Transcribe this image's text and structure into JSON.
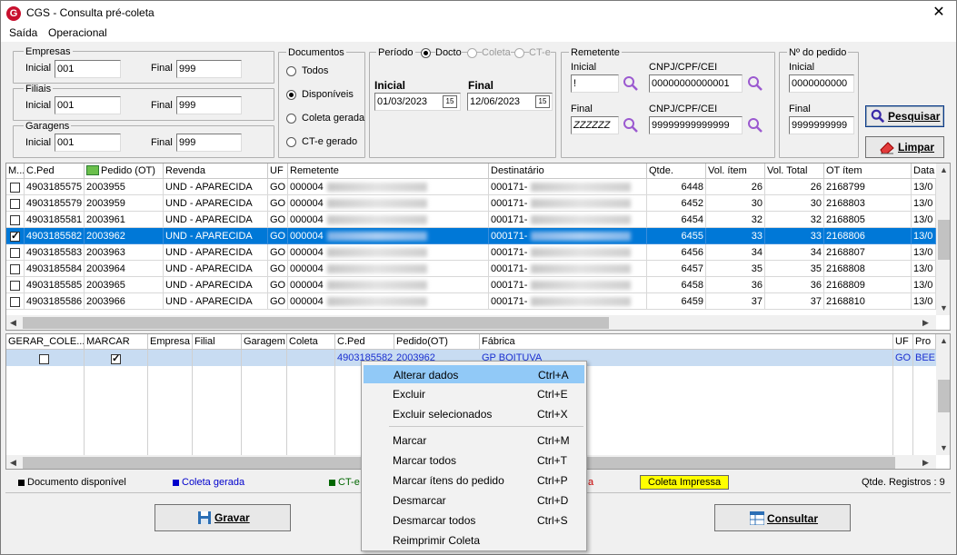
{
  "window": {
    "title": "CGS - Consulta pré-coleta",
    "close": "✕"
  },
  "menu": [
    "Saída",
    "Operacional"
  ],
  "filters": {
    "empresas": {
      "legend": "Empresas",
      "inicial_label": "Inicial",
      "inicial": "001",
      "final_label": "Final",
      "final": "999"
    },
    "filiais": {
      "legend": "Filiais",
      "inicial_label": "Inicial",
      "inicial": "001",
      "final_label": "Final",
      "final": "999"
    },
    "garagens": {
      "legend": "Garagens",
      "inicial_label": "Inicial",
      "inicial": "001",
      "final_label": "Final",
      "final": "999"
    },
    "documentos": {
      "legend": "Documentos",
      "options": [
        "Todos",
        "Disponíveis",
        "Coleta gerada",
        "CT-e gerado"
      ],
      "selected": "Disponíveis"
    },
    "periodo": {
      "legend": "Período",
      "options": [
        "Docto",
        "Coleta",
        "CT-e"
      ],
      "selected": "Docto",
      "inicial_label": "Inicial",
      "inicial": "01/03/2023",
      "final_label": "Final",
      "final": "12/06/2023",
      "cal_icon": "15"
    },
    "remetente": {
      "legend": "Remetente",
      "inicial_label": "Inicial",
      "inicial": "!",
      "cnpj_label": "CNPJ/CPF/CEI",
      "cnpj_inicial": "00000000000001",
      "final_label": "Final",
      "final": "ZZZZZZ",
      "cnpj_final": "99999999999999"
    },
    "pedido": {
      "legend": "Nº do pedido",
      "inicial_label": "Inicial",
      "inicial": "0000000000",
      "final_label": "Final",
      "final": "9999999999"
    }
  },
  "buttons": {
    "pesquisar": "Pesquisar",
    "limpar": "Limpar",
    "gravar": "Gravar",
    "consultar": "Consultar"
  },
  "top_grid": {
    "headers": [
      "M...",
      "C.Ped",
      "Pedido (OT)",
      "Revenda",
      "UF",
      "Remetente",
      "Destinatário",
      "Qtde.",
      "Vol. ítem",
      "Vol. Total",
      "OT ítem",
      "Data"
    ],
    "rows": [
      {
        "checked": false,
        "cped": "4903185575",
        "pedido": "2003955",
        "revenda": "UND - APARECIDA",
        "uf": "GO",
        "rem": "000004",
        "dest": "000171-",
        "qtde": "6448",
        "vol_item": "26",
        "vol_total": "26",
        "ot_item": "2168799",
        "data": "13/0"
      },
      {
        "checked": false,
        "cped": "4903185579",
        "pedido": "2003959",
        "revenda": "UND - APARECIDA",
        "uf": "GO",
        "rem": "000004",
        "dest": "000171-",
        "qtde": "6452",
        "vol_item": "30",
        "vol_total": "30",
        "ot_item": "2168803",
        "data": "13/0"
      },
      {
        "checked": false,
        "cped": "4903185581",
        "pedido": "2003961",
        "revenda": "UND - APARECIDA",
        "uf": "GO",
        "rem": "000004",
        "dest": "000171-",
        "qtde": "6454",
        "vol_item": "32",
        "vol_total": "32",
        "ot_item": "2168805",
        "data": "13/0"
      },
      {
        "checked": true,
        "cped": "4903185582",
        "pedido": "2003962",
        "revenda": "UND - APARECIDA",
        "uf": "GO",
        "rem": "000004",
        "dest": "000171-",
        "qtde": "6455",
        "vol_item": "33",
        "vol_total": "33",
        "ot_item": "2168806",
        "data": "13/0",
        "selected": true
      },
      {
        "checked": false,
        "cped": "4903185583",
        "pedido": "2003963",
        "revenda": "UND - APARECIDA",
        "uf": "GO",
        "rem": "000004",
        "dest": "000171-",
        "qtde": "6456",
        "vol_item": "34",
        "vol_total": "34",
        "ot_item": "2168807",
        "data": "13/0"
      },
      {
        "checked": false,
        "cped": "4903185584",
        "pedido": "2003964",
        "revenda": "UND - APARECIDA",
        "uf": "GO",
        "rem": "000004",
        "dest": "000171-",
        "qtde": "6457",
        "vol_item": "35",
        "vol_total": "35",
        "ot_item": "2168808",
        "data": "13/0"
      },
      {
        "checked": false,
        "cped": "4903185585",
        "pedido": "2003965",
        "revenda": "UND - APARECIDA",
        "uf": "GO",
        "rem": "000004",
        "dest": "000171-",
        "qtde": "6458",
        "vol_item": "36",
        "vol_total": "36",
        "ot_item": "2168809",
        "data": "13/0"
      },
      {
        "checked": false,
        "cped": "4903185586",
        "pedido": "2003966",
        "revenda": "UND - APARECIDA",
        "uf": "GO",
        "rem": "000004",
        "dest": "000171-",
        "qtde": "6459",
        "vol_item": "37",
        "vol_total": "37",
        "ot_item": "2168810",
        "data": "13/0"
      }
    ]
  },
  "bottom_grid": {
    "headers": [
      "GERAR_COLE...",
      "MARCAR",
      "Empresa",
      "Filial",
      "Garagem",
      "Coleta",
      "C.Ped",
      "Pedido(OT)",
      "Fábrica",
      "UF",
      "Pro"
    ],
    "row": {
      "gerar": false,
      "marcar": true,
      "cped": "4903185582",
      "pedido": "2003962",
      "fabrica": "GP BOITUVA",
      "uf": "GO",
      "pro": "BEE"
    }
  },
  "status_legend": {
    "disponivel": "Documento disponível",
    "coleta_gerada": "Coleta gerada",
    "cte": "CT-e",
    "impressa": "Coleta Impressa",
    "qtde_registros": "Qtde. Registros : 9",
    "colors": {
      "disponivel": "#000000",
      "coleta_gerada": "#0000cc",
      "cte": "#006600",
      "impressa_bg": "#ffff00",
      "red": "#cc0000"
    }
  },
  "context_menu": [
    {
      "label": "Alterar dados",
      "shortcut": "Ctrl+A",
      "highlighted": true
    },
    {
      "label": "Excluir",
      "shortcut": "Ctrl+E"
    },
    {
      "label": "Excluir selecionados",
      "shortcut": "Ctrl+X"
    },
    {
      "label": "Marcar",
      "shortcut": "Ctrl+M"
    },
    {
      "label": "Marcar todos",
      "shortcut": "Ctrl+T"
    },
    {
      "label": "Marcar ítens do pedido",
      "shortcut": "Ctrl+P"
    },
    {
      "label": "Desmarcar",
      "shortcut": "Ctrl+D"
    },
    {
      "label": "Desmarcar todos",
      "shortcut": "Ctrl+S"
    },
    {
      "label": "Reimprimir Coleta",
      "shortcut": ""
    }
  ],
  "icons": {
    "app": "G",
    "search": "magnifier-icon",
    "eraser": "eraser-icon",
    "save": "floppy-icon",
    "consult": "grid-icon",
    "calendar": "calendar-icon",
    "money": "money-icon"
  }
}
